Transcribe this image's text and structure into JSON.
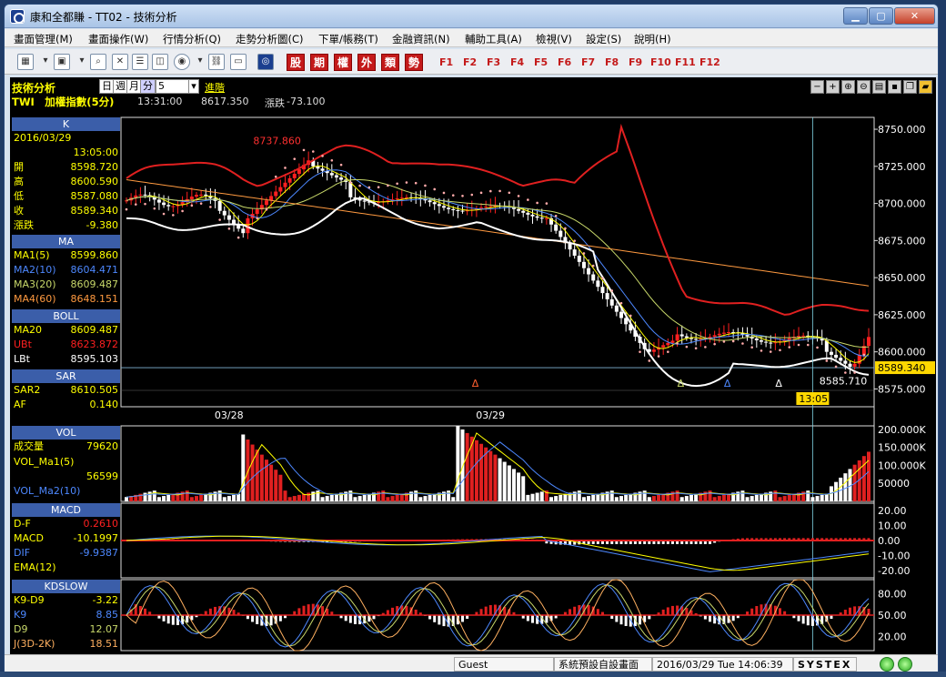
{
  "window": {
    "title": "康和全都賺 - TT02 - 技術分析"
  },
  "menu": [
    "畫面管理(M)",
    "畫面操作(W)",
    "行情分析(Q)",
    "走勢分析圖(C)",
    "下單/帳務(T)",
    "金融資訊(N)",
    "輔助工具(A)",
    "檢視(V)",
    "設定(S)",
    "說明(H)"
  ],
  "toolbar": {
    "keys": [
      "股",
      "期",
      "權",
      "外",
      "類",
      "勢"
    ],
    "fkeys": [
      "F1",
      "F2",
      "F3",
      "F4",
      "F5",
      "F6",
      "F7",
      "F8",
      "F9",
      "F10",
      "F11",
      "F12"
    ]
  },
  "header": {
    "title": "技術分析",
    "period_day": "日",
    "period_week": "週",
    "period_month": "月",
    "period_min": "分",
    "interval": "5",
    "advanced": "進階",
    "symbol_line": "TWI　加權指數(5分)",
    "time": "13:31:00",
    "price": "8617.350",
    "change_label": "漲跌",
    "change": "-73.100"
  },
  "k_panel": {
    "title": "K",
    "date": "2016/03/29",
    "time": "13:05:00",
    "rows": [
      {
        "k": "開",
        "v": "8598.720"
      },
      {
        "k": "高",
        "v": "8600.590"
      },
      {
        "k": "低",
        "v": "8587.080"
      },
      {
        "k": "收",
        "v": "8589.340"
      },
      {
        "k": "漲跌",
        "v": "-9.380"
      }
    ]
  },
  "ma_panel": {
    "title": "MA",
    "rows": [
      {
        "k": "MA1(5)",
        "v": "8599.860",
        "c": "#ffff00"
      },
      {
        "k": "MA2(10)",
        "v": "8604.471",
        "c": "#4d88ff"
      },
      {
        "k": "MA3(20)",
        "v": "8609.487",
        "c": "#c8d86a"
      },
      {
        "k": "MA4(60)",
        "v": "8648.151",
        "c": "#ff9a40"
      }
    ]
  },
  "boll_panel": {
    "title": "BOLL",
    "rows": [
      {
        "k": "MA20",
        "v": "8609.487",
        "c": "#ffff00"
      },
      {
        "k": "UBt",
        "v": "8623.872",
        "c": "#ff2020"
      },
      {
        "k": "LBt",
        "v": "8595.103",
        "c": "#ffffff"
      }
    ]
  },
  "sar_panel": {
    "title": "SAR",
    "rows": [
      {
        "k": "SAR2",
        "v": "8610.505",
        "c": "#ffff00"
      },
      {
        "k": "AF",
        "v": "0.140",
        "c": "#ffff00"
      }
    ]
  },
  "vol_panel": {
    "title": "VOL",
    "rows": [
      {
        "k": "成交量",
        "v": "79620",
        "c": "#ffff00"
      },
      {
        "k": "VOL_Ma1(5)",
        "v": "",
        "c": "#ffff00"
      },
      {
        "k": "",
        "v": "56599",
        "c": "#ffff00"
      },
      {
        "k": "VOL_Ma2(10)",
        "v": "",
        "c": "#4d88ff"
      }
    ]
  },
  "macd_panel": {
    "title": "MACD",
    "rows": [
      {
        "k": "D-F",
        "v": "0.2610",
        "c": "#ff2020"
      },
      {
        "k": "MACD",
        "v": "-10.1997",
        "c": "#ffff00"
      },
      {
        "k": "DIF",
        "v": "-9.9387",
        "c": "#4d88ff"
      },
      {
        "k": "EMA(12)",
        "v": "",
        "c": "#ffff00"
      }
    ]
  },
  "kd_panel": {
    "title": "KDSLOW",
    "rows": [
      {
        "k": "K9-D9",
        "v": "-3.22",
        "c": "#ffff00"
      },
      {
        "k": "K9",
        "v": "8.85",
        "c": "#4d88ff"
      },
      {
        "k": "D9",
        "v": "12.07",
        "c": "#c8d86a"
      },
      {
        "k": "J(3D-2K)",
        "v": "18.51",
        "c": "#ffb060"
      }
    ]
  },
  "chart_data": {
    "type": "candlestick",
    "price_axis": [
      "8750.000",
      "8725.000",
      "8700.000",
      "8675.000",
      "8650.000",
      "8625.000",
      "8600.000",
      "8575.000"
    ],
    "price_ylim": [
      8563,
      8758
    ],
    "last_price": "8589.340",
    "high_label": "8737.860",
    "low_label": "8585.710",
    "date_labels": [
      "03/28",
      "03/29"
    ],
    "cursor_time": "13:05",
    "vol_axis": [
      "200.000K",
      "150.000K",
      "100.000K",
      "50000"
    ],
    "macd_axis": [
      "20.00",
      "10.00",
      "0.00",
      "-10.00",
      "-20.00"
    ],
    "kd_axis": [
      "80.00",
      "50.00",
      "20.00"
    ]
  },
  "status": {
    "user": "Guest",
    "layout": "系統預設自設畫面",
    "datetime": "2016/03/29 Tue 14:06:39",
    "brand": "SYSTEX"
  }
}
